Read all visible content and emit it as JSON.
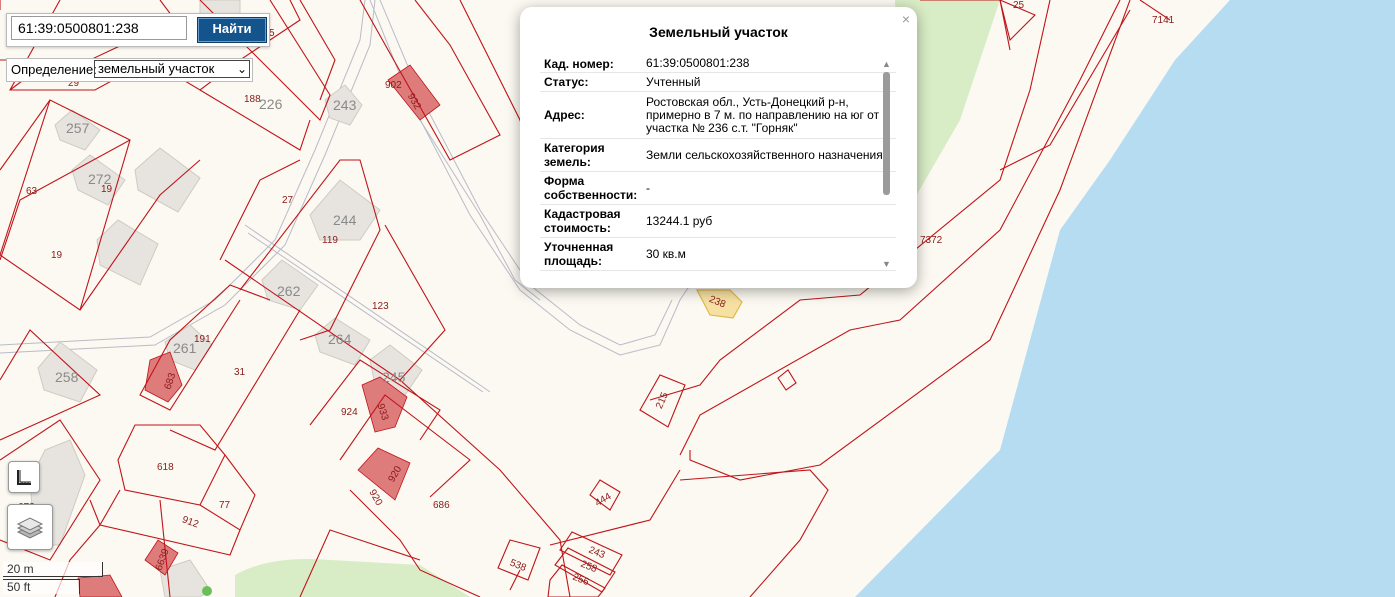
{
  "search": {
    "value": "61:39:0500801:238",
    "button_label": "Найти"
  },
  "definition": {
    "label": "Определение:",
    "selected": "земельный участок"
  },
  "popup": {
    "title": "Земельный участок",
    "close": "×",
    "rows": [
      {
        "label": "Кад. номер:",
        "value": "61:39:0500801:238"
      },
      {
        "label": "Статус:",
        "value": "Учтенный"
      },
      {
        "label": "Адрес:",
        "value": "Ростовская обл., Усть-Донецкий р-н, примерно в 7 м. по направлению на юг от участка № 236 с.т. \"Горняк\""
      },
      {
        "label": "Категория земель:",
        "value": "Земли сельскохозяйственного назначения"
      },
      {
        "label": "Форма собственности:",
        "value": "-"
      },
      {
        "label": "Кадастровая стоимость:",
        "value": "13244.1 руб"
      },
      {
        "label": "Уточненная площадь:",
        "value": "30 кв.м"
      }
    ]
  },
  "scale": {
    "metric": "20 m",
    "imperial": "50 ft"
  },
  "parcel_labels": [
    "29",
    "27",
    "188",
    "226",
    "243",
    "902",
    "932",
    "257",
    "272",
    "19",
    "63",
    "19",
    "27",
    "244",
    "119",
    "123",
    "262",
    "264",
    "261",
    "191",
    "683",
    "31",
    "258",
    "245",
    "924",
    "933",
    "920",
    "920",
    "686",
    "618",
    "77",
    "912",
    "6639",
    "672",
    "444",
    "215",
    "7372",
    "7141",
    "243",
    "258",
    "256",
    "538",
    "238",
    "25",
    "5"
  ],
  "building_labels": [
    "226",
    "243",
    "257",
    "272",
    "244",
    "262",
    "264",
    "261",
    "258",
    "245"
  ],
  "icons": [
    "ruler-icon",
    "layers-icon",
    "close-icon"
  ],
  "colors": {
    "parcel_border": "#c0141a",
    "building": "#e7e4df",
    "highlight_parcel": "#de7b7b",
    "water": "#b6dcf2",
    "green": "#d8ecc5",
    "road": "#b9bbc9",
    "selected_parcel": "#f6e1a3",
    "button": "#14548d"
  }
}
